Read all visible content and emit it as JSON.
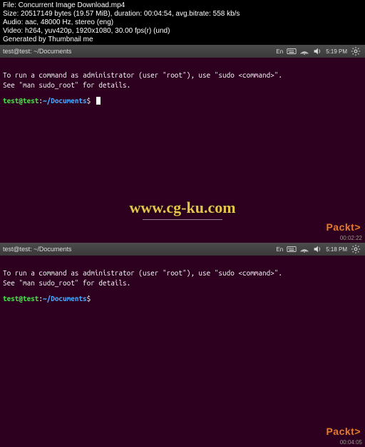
{
  "metadata": {
    "file": "File: Concurrent Image Download.mp4",
    "size": "Size: 20517149 bytes (19.57 MiB), duration: 00:04:54, avg.bitrate: 558 kb/s",
    "audio": "Audio: aac, 48000 Hz, stereo (eng)",
    "video": "Video: h264, yuv420p, 1920x1080, 30.00 fps(r) (und)",
    "generated": "Generated by Thumbnail me"
  },
  "terminal": {
    "title": "test@test: ~/Documents",
    "line1": "To run a command as administrator (user \"root\"), use \"sudo <command>\".",
    "line2": "See \"man sudo_root\" for details.",
    "prompt_user": "test@test",
    "prompt_sep": ":",
    "prompt_path": "~/Documents",
    "prompt_dollar": "$"
  },
  "panel": {
    "lang": "En",
    "time_top": "5:19 PM",
    "time_bottom": "5:18 PM"
  },
  "watermark": "www.cg-ku.com",
  "brand": {
    "name": "Packt",
    "suffix": ">"
  },
  "timecode": {
    "top": "00:02:22",
    "bottom": "00:04:05"
  }
}
